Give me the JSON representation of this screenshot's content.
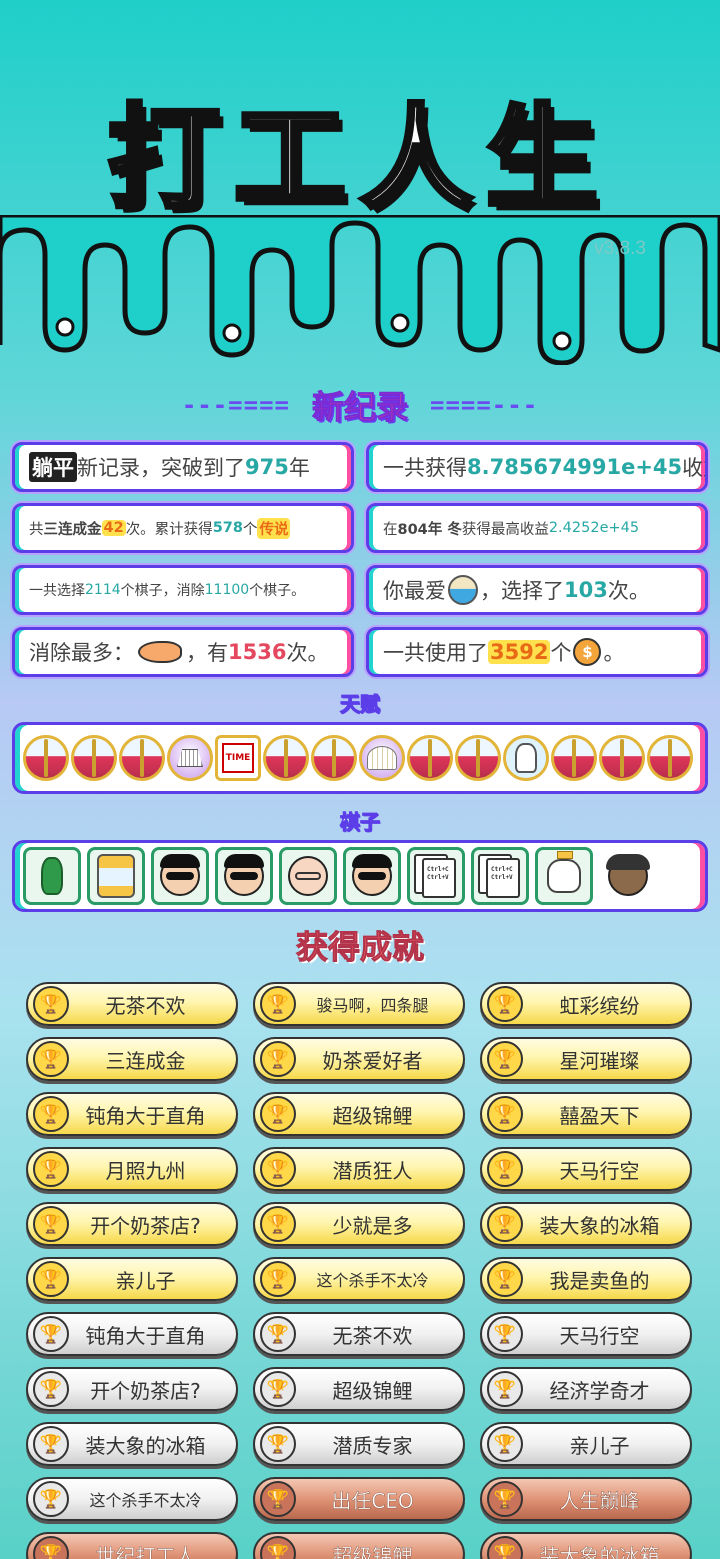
{
  "app": {
    "title": "打工人生",
    "version": "v3.8.3"
  },
  "record": {
    "heading": "新纪录",
    "dash_left": "---====",
    "dash_right": "====---"
  },
  "stats": [
    {
      "pre": "",
      "tag": "躺平",
      "mid": "新记录，突破到了",
      "num": "975",
      "post": "年"
    },
    {
      "pre": "一共获得",
      "num": "8.785674991e+45",
      "post": "收益"
    },
    {
      "pre": "共",
      "b1": "三连成金",
      "num1": "42",
      "mid": "次。累计获得",
      "num2": "578",
      "mid2": "个",
      "tag": "传说"
    },
    {
      "pre": "在 ",
      "b1": "804年 冬",
      "mid": " 获得最高收益",
      "num": "2.4252e+45"
    },
    {
      "pre": "一共选择",
      "num1": "2114",
      "mid": "个棋子，消除",
      "num2": "11100",
      "post": "个棋子。"
    },
    {
      "pre": "你最爱",
      "icon": "noodle-bowl-icon",
      "mid": "，选择了",
      "num": "103",
      "post": "次。"
    },
    {
      "pre": "消除最多：",
      "icon": "fish-icon",
      "mid": "，有",
      "num": "1536",
      "post": "次。"
    },
    {
      "pre": "一共使用了",
      "num": "3592",
      "mid": "个",
      "icon": "coin-icon",
      "post": "。"
    }
  ],
  "talent_heading": "天赋",
  "talents": [
    "capsule-icon",
    "capsule-icon",
    "capsule-icon",
    "skirt-icon",
    "time-magazine-icon",
    "capsule-icon",
    "capsule-icon",
    "shell-icon",
    "capsule-icon",
    "capsule-icon",
    "husky-dog-icon",
    "capsule-icon",
    "capsule-icon",
    "capsule-icon"
  ],
  "pieces_heading": "棋子",
  "pieces": [
    "green-bottle-icon",
    "claw-machine-icon",
    "sunglasses-man-icon",
    "sunglasses-man-icon",
    "bald-glasses-man-icon",
    "sunglasses-man-icon",
    "copy-paste-cards-icon",
    "copy-paste-cards-icon",
    "crowned-husky-icon",
    "bucket-hat-man-icon"
  ],
  "copy_paste_text": [
    "Ctrl+C",
    "Ctrl+V"
  ],
  "time_label": "TIME",
  "achievements_heading": "获得成就",
  "achievements": [
    {
      "name": "无茶不欢",
      "tier": "gold"
    },
    {
      "name": "骏马啊，四条腿",
      "tier": "gold"
    },
    {
      "name": "虹彩缤纷",
      "tier": "gold"
    },
    {
      "name": "三连成金",
      "tier": "gold"
    },
    {
      "name": "奶茶爱好者",
      "tier": "gold"
    },
    {
      "name": "星河璀璨",
      "tier": "gold"
    },
    {
      "name": "钝角大于直角",
      "tier": "gold"
    },
    {
      "name": "超级锦鲤",
      "tier": "gold"
    },
    {
      "name": "囍盈天下",
      "tier": "gold"
    },
    {
      "name": "月照九州",
      "tier": "gold"
    },
    {
      "name": "潜质狂人",
      "tier": "gold"
    },
    {
      "name": "天马行空",
      "tier": "gold"
    },
    {
      "name": "开个奶茶店?",
      "tier": "gold"
    },
    {
      "name": "少就是多",
      "tier": "gold"
    },
    {
      "name": "装大象的冰箱",
      "tier": "gold"
    },
    {
      "name": "亲儿子",
      "tier": "gold"
    },
    {
      "name": "这个杀手不太冷",
      "tier": "gold"
    },
    {
      "name": "我是卖鱼的",
      "tier": "gold"
    },
    {
      "name": "钝角大于直角",
      "tier": "silver"
    },
    {
      "name": "无茶不欢",
      "tier": "silver"
    },
    {
      "name": "天马行空",
      "tier": "silver"
    },
    {
      "name": "开个奶茶店?",
      "tier": "silver"
    },
    {
      "name": "超级锦鲤",
      "tier": "silver"
    },
    {
      "name": "经济学奇才",
      "tier": "silver"
    },
    {
      "name": "装大象的冰箱",
      "tier": "silver"
    },
    {
      "name": "潜质专家",
      "tier": "silver"
    },
    {
      "name": "亲儿子",
      "tier": "silver"
    },
    {
      "name": "这个杀手不太冷",
      "tier": "silver"
    },
    {
      "name": "出任CEO",
      "tier": "bronze"
    },
    {
      "name": "人生巅峰",
      "tier": "bronze"
    },
    {
      "name": "世纪打工人",
      "tier": "bronze"
    },
    {
      "name": "超级锦鲤",
      "tier": "bronze"
    },
    {
      "name": "装大象的冰箱",
      "tier": "bronze"
    }
  ],
  "colors": {
    "accent_purple": "#5b3ee8",
    "accent_pink": "#ff4fa3",
    "accent_teal": "#22d3d0",
    "number_teal": "#28a8a4",
    "number_red": "#e4475e"
  }
}
